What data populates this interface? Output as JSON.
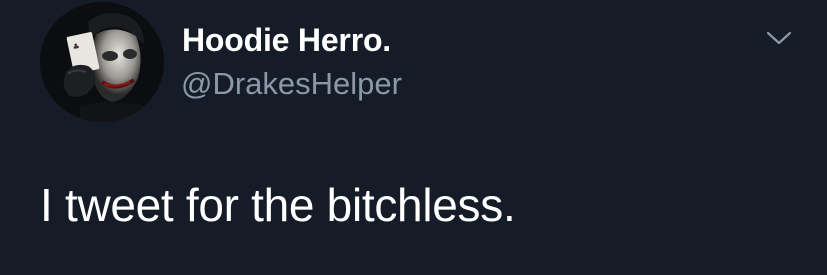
{
  "tweet": {
    "author": {
      "display_name": "Hoodie Herro.",
      "handle": "@DrakesHelper",
      "avatar_icon": "avatar-joker-with-card"
    },
    "text": "I tweet for the bitchless.",
    "more_icon": "chevron-down-icon"
  },
  "colors": {
    "background": "#151c28",
    "primary_text": "#ffffff",
    "secondary_text": "#8a98a8"
  }
}
